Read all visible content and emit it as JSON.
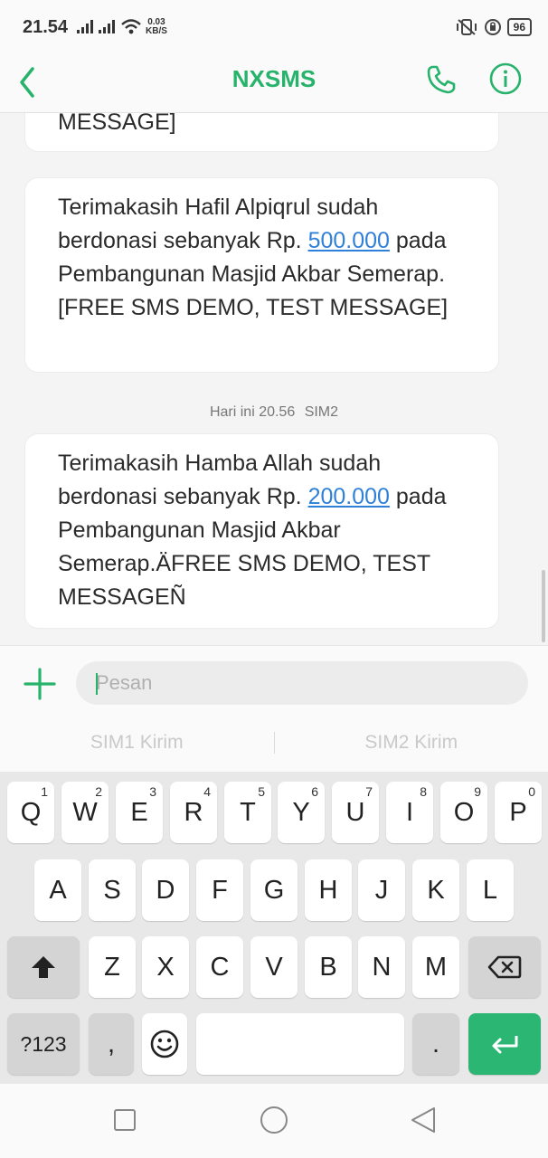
{
  "status_bar": {
    "time": "21.54",
    "net_speed_value": "0.03",
    "net_speed_unit": "KB/S",
    "battery": "96"
  },
  "header": {
    "title": "NXSMS",
    "accent_color": "#27b36b"
  },
  "messages": [
    {
      "lines": [
        "MESSAGE]"
      ]
    },
    {
      "before_link": "Terimakasih Hafil Alpiqrul sudah berdonasi sebanyak Rp. ",
      "link": "500.000",
      "after_link": " pada Pembangunan Masjid Akbar Semerap.[FREE SMS DEMO, TEST MESSAGE]"
    },
    {
      "before_link": "Terimakasih Hamba Allah sudah berdonasi sebanyak Rp. ",
      "link": "200.000",
      "after_link": " pada Pembangunan Masjid Akbar Semerap.ÄFREE SMS DEMO, TEST MESSAGEÑ"
    }
  ],
  "timestamp": {
    "time": "Hari ini 20.56",
    "sim": "SIM2"
  },
  "composer": {
    "placeholder": "Pesan",
    "sim1_send": "SIM1 Kirim",
    "sim2_send": "SIM2 Kirim"
  },
  "keyboard": {
    "row1": [
      {
        "key": "Q",
        "hint": "1"
      },
      {
        "key": "W",
        "hint": "2"
      },
      {
        "key": "E",
        "hint": "3"
      },
      {
        "key": "R",
        "hint": "4"
      },
      {
        "key": "T",
        "hint": "5"
      },
      {
        "key": "Y",
        "hint": "6"
      },
      {
        "key": "U",
        "hint": "7"
      },
      {
        "key": "I",
        "hint": "8"
      },
      {
        "key": "O",
        "hint": "9"
      },
      {
        "key": "P",
        "hint": "0"
      }
    ],
    "row2": [
      "A",
      "S",
      "D",
      "F",
      "G",
      "H",
      "J",
      "K",
      "L"
    ],
    "row3": [
      "Z",
      "X",
      "C",
      "V",
      "B",
      "N",
      "M"
    ],
    "symbols": "?123",
    "comma": ",",
    "period": "."
  }
}
